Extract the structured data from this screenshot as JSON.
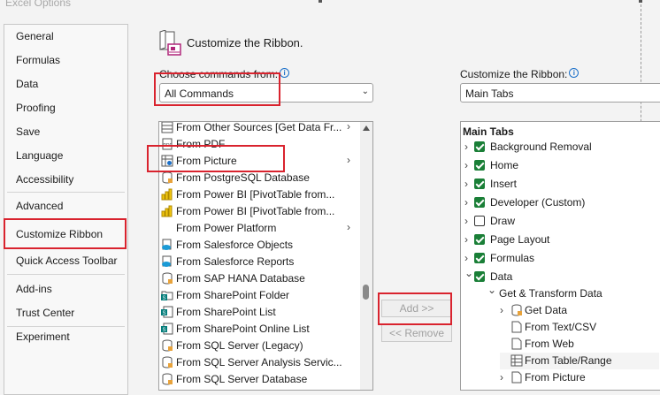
{
  "window": {
    "title": "Excel Options"
  },
  "nav": {
    "items": [
      {
        "label": "General"
      },
      {
        "label": "Formulas"
      },
      {
        "label": "Data"
      },
      {
        "label": "Proofing"
      },
      {
        "label": "Save"
      },
      {
        "label": "Language"
      },
      {
        "label": "Accessibility"
      },
      {
        "label": "Advanced"
      },
      {
        "label": "Customize Ribbon",
        "selected": true
      },
      {
        "label": "Quick Access Toolbar"
      },
      {
        "label": "Add-ins"
      },
      {
        "label": "Trust Center"
      },
      {
        "label": "Experiment"
      }
    ]
  },
  "header": {
    "title": "Customize the Ribbon."
  },
  "commands": {
    "label": "Choose commands from:",
    "selected": "All Commands",
    "items": [
      {
        "label": "From Other Sources [Get Data Fr...",
        "icon": "data-source-icon",
        "submenu": true
      },
      {
        "label": "From PDF",
        "icon": "pdf-icon",
        "submenu": false
      },
      {
        "label": "From Picture",
        "icon": "picture-table-icon",
        "submenu": true
      },
      {
        "label": "From PostgreSQL Database",
        "icon": "database-icon",
        "submenu": false
      },
      {
        "label": "From Power BI [PivotTable from...",
        "icon": "power-bi-icon",
        "submenu": false
      },
      {
        "label": "From Power BI [PivotTable from...",
        "icon": "power-bi-icon",
        "submenu": false
      },
      {
        "label": "From Power Platform",
        "icon": "",
        "submenu": true
      },
      {
        "label": "From Salesforce Objects",
        "icon": "salesforce-icon",
        "submenu": false
      },
      {
        "label": "From Salesforce Reports",
        "icon": "salesforce-icon",
        "submenu": false
      },
      {
        "label": "From SAP HANA Database",
        "icon": "database-icon",
        "submenu": false
      },
      {
        "label": "From SharePoint Folder",
        "icon": "sharepoint-folder-icon",
        "submenu": false
      },
      {
        "label": "From SharePoint List",
        "icon": "sharepoint-icon",
        "submenu": false
      },
      {
        "label": "From SharePoint Online List",
        "icon": "sharepoint-icon",
        "submenu": false
      },
      {
        "label": "From SQL Server (Legacy)",
        "icon": "database-icon",
        "submenu": false
      },
      {
        "label": "From SQL Server Analysis Servic...",
        "icon": "database-icon",
        "submenu": false
      },
      {
        "label": "From SQL Server Database",
        "icon": "database-icon",
        "submenu": false
      }
    ]
  },
  "buttons": {
    "add": "Add >>",
    "remove": "<< Remove"
  },
  "ribbon": {
    "label": "Customize the Ribbon:",
    "selected": "Main Tabs",
    "tree_header": "Main Tabs",
    "tabs": [
      {
        "label": "Background Removal",
        "checked": true,
        "expander": ">"
      },
      {
        "label": "Home",
        "checked": true,
        "expander": ">"
      },
      {
        "label": "Insert",
        "checked": true,
        "expander": ">"
      },
      {
        "label": "Developer (Custom)",
        "checked": true,
        "expander": ">"
      },
      {
        "label": "Draw",
        "checked": false,
        "expander": ">"
      },
      {
        "label": "Page Layout",
        "checked": true,
        "expander": ">"
      },
      {
        "label": "Formulas",
        "checked": true,
        "expander": ">"
      },
      {
        "label": "Data",
        "checked": true,
        "expander": "v"
      }
    ],
    "data_children": [
      {
        "label": "Get & Transform Data",
        "level": 1
      },
      {
        "label": "Get Data",
        "level": 2
      },
      {
        "label": "From Text/CSV",
        "level": 2
      },
      {
        "label": "From Web",
        "level": 2
      },
      {
        "label": "From Table/Range",
        "level": 2
      },
      {
        "label": "From Picture",
        "level": 2
      }
    ]
  },
  "colors": {
    "highlight": "#d9232e",
    "check_green": "#1a7f37",
    "info_blue": "#1a6fc9"
  }
}
